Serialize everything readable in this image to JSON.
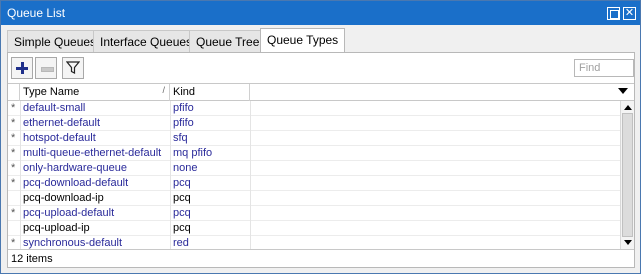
{
  "window": {
    "title": "Queue List"
  },
  "tabs": [
    {
      "label": "Simple Queues"
    },
    {
      "label": "Interface Queues"
    },
    {
      "label": "Queue Tree"
    },
    {
      "label": "Queue Types"
    }
  ],
  "active_tab": "Queue Types",
  "toolbar": {
    "add_icon": "plus-icon",
    "remove_icon": "minus-icon",
    "filter_icon": "filter-icon",
    "find_placeholder": "Find"
  },
  "table": {
    "columns": [
      "Type Name",
      "Kind"
    ],
    "rows": [
      {
        "mark": "*",
        "name": "default-small",
        "kind": "pfifo",
        "is_default": true
      },
      {
        "mark": "*",
        "name": "ethernet-default",
        "kind": "pfifo",
        "is_default": true
      },
      {
        "mark": "*",
        "name": "hotspot-default",
        "kind": "sfq",
        "is_default": true
      },
      {
        "mark": "*",
        "name": "multi-queue-ethernet-default",
        "kind": "mq pfifo",
        "is_default": true
      },
      {
        "mark": "*",
        "name": "only-hardware-queue",
        "kind": "none",
        "is_default": true
      },
      {
        "mark": "*",
        "name": "pcq-download-default",
        "kind": "pcq",
        "is_default": true
      },
      {
        "mark": "",
        "name": "pcq-download-ip",
        "kind": "pcq",
        "is_default": false
      },
      {
        "mark": "*",
        "name": "pcq-upload-default",
        "kind": "pcq",
        "is_default": true
      },
      {
        "mark": "",
        "name": "pcq-upload-ip",
        "kind": "pcq",
        "is_default": false
      },
      {
        "mark": "*",
        "name": "synchronous-default",
        "kind": "red",
        "is_default": true
      }
    ]
  },
  "status": {
    "count_text": "12 items"
  },
  "colors": {
    "titlebar": "#1a6fc9",
    "default_row_text": "#2a2a9a"
  }
}
